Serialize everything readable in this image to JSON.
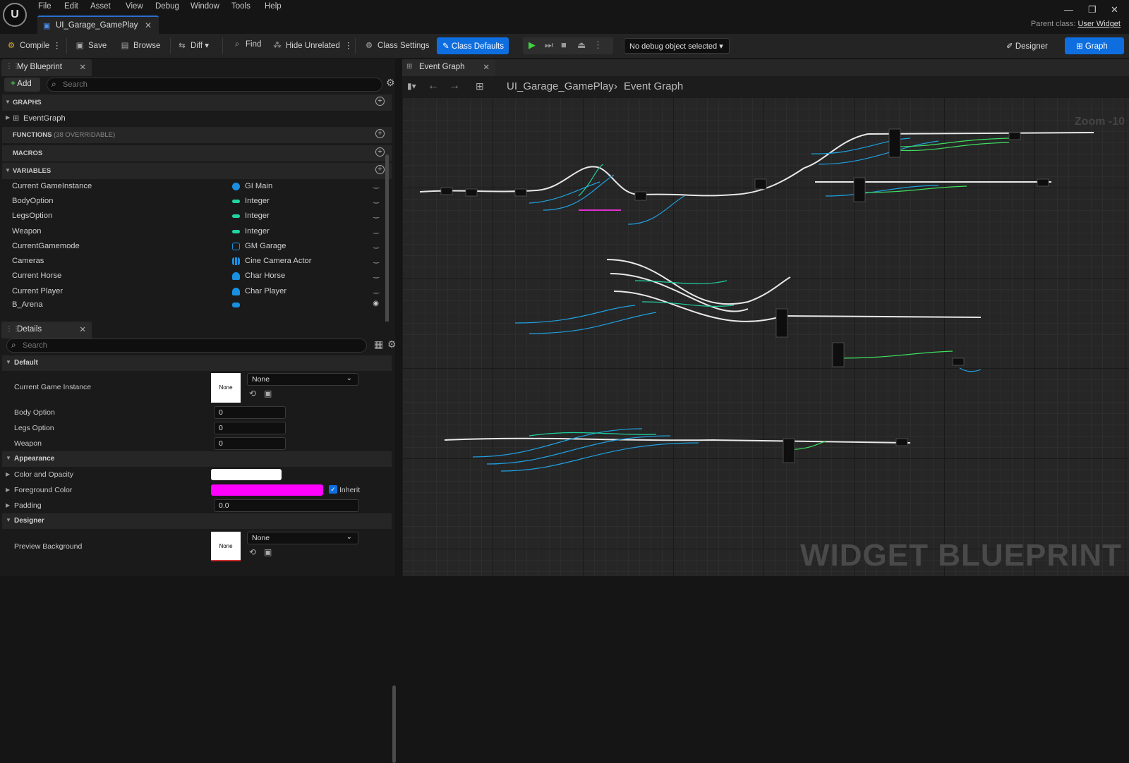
{
  "menu": {
    "logo": "U",
    "items": [
      "File",
      "Edit",
      "Asset",
      "View",
      "Debug",
      "Window",
      "Tools",
      "Help"
    ]
  },
  "document_tab": {
    "title": "UI_Garage_GamePlay"
  },
  "parent_class": {
    "label": "Parent class:",
    "value": "User Widget"
  },
  "toolbar": {
    "compile": "Compile",
    "save": "Save",
    "browse": "Browse",
    "diff": "Diff",
    "find": "Find",
    "hide_unrelated": "Hide Unrelated",
    "class_settings": "Class Settings",
    "class_defaults": "Class Defaults",
    "debug_object": "No debug object selected",
    "designer": "Designer",
    "graph": "Graph"
  },
  "my_blueprint": {
    "tab": "My Blueprint",
    "add": "Add",
    "search_placeholder": "Search",
    "graphs": {
      "label": "GRAPHS",
      "items": [
        "EventGraph"
      ]
    },
    "functions": {
      "label": "FUNCTIONS",
      "sub": "(38 OVERRIDABLE)"
    },
    "macros": {
      "label": "MACROS"
    },
    "variables": {
      "label": "VARIABLES",
      "items": [
        {
          "name": "Current GameInstance",
          "type": "GI Main",
          "color": "#1a8fe0"
        },
        {
          "name": "BodyOption",
          "type": "Integer",
          "color": "#1fd6a0"
        },
        {
          "name": "LegsOption",
          "type": "Integer",
          "color": "#1fd6a0"
        },
        {
          "name": "Weapon",
          "type": "Integer",
          "color": "#1fd6a0"
        },
        {
          "name": "CurrentGamemode",
          "type": "GM Garage",
          "color": "#1a8fe0"
        },
        {
          "name": "Cameras",
          "type": "Cine Camera Actor",
          "color": "#1a8fe0"
        },
        {
          "name": "Current Horse",
          "type": "Char Horse",
          "color": "#1a8fe0"
        },
        {
          "name": "Current Player",
          "type": "Char Player",
          "color": "#1a8fe0"
        },
        {
          "name": "B_Arena",
          "type": "",
          "color": "#1a8fe0"
        }
      ]
    }
  },
  "details": {
    "tab": "Details",
    "search_placeholder": "Search",
    "default": {
      "label": "Default",
      "current_game_instance": {
        "label": "Current Game Instance",
        "thumb": "None",
        "value": "None"
      },
      "body_option": {
        "label": "Body Option",
        "value": "0"
      },
      "legs_option": {
        "label": "Legs Option",
        "value": "0"
      },
      "weapon": {
        "label": "Weapon",
        "value": "0"
      }
    },
    "appearance": {
      "label": "Appearance",
      "color_opacity": {
        "label": "Color and Opacity",
        "color": "#ffffff"
      },
      "foreground": {
        "label": "Foreground Color",
        "color": "#ff00ff",
        "inherit": "Inherit"
      },
      "padding": {
        "label": "Padding",
        "value": "0.0"
      }
    },
    "designer": {
      "label": "Designer",
      "preview_bg": {
        "label": "Preview Background",
        "thumb": "None",
        "value": "None"
      }
    }
  },
  "graph_editor": {
    "tab": "Event Graph",
    "breadcrumb": [
      "UI_Garage_GamePlay",
      "Event Graph"
    ],
    "zoom": "Zoom -10",
    "watermark": "WIDGET BLUEPRINT"
  }
}
